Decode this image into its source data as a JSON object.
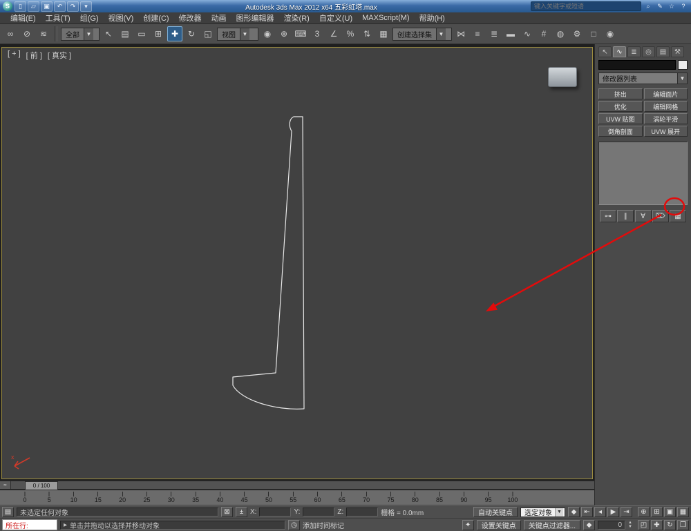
{
  "title_bar": {
    "title": "Autodesk 3ds Max 2012 x64  五彩虹塔.max",
    "search_placeholder": "键入关键字或短语",
    "quick_access": [
      {
        "name": "new-file-icon",
        "glyph": "▯"
      },
      {
        "name": "open-file-icon",
        "glyph": "▱"
      },
      {
        "name": "save-file-icon",
        "glyph": "▣"
      },
      {
        "name": "undo-icon",
        "glyph": "↶"
      },
      {
        "name": "redo-icon",
        "glyph": "↷"
      },
      {
        "name": "quick-access-dropdown-icon",
        "glyph": "▾"
      }
    ],
    "right_icons": [
      {
        "name": "search-icon",
        "glyph": "⌕"
      },
      {
        "name": "communication-center-icon",
        "glyph": "✎"
      },
      {
        "name": "favorites-star-icon",
        "glyph": "☆"
      },
      {
        "name": "help-icon",
        "glyph": "?"
      }
    ]
  },
  "menus": [
    "编辑(E)",
    "工具(T)",
    "组(G)",
    "视图(V)",
    "创建(C)",
    "修改器",
    "动画",
    "图形编辑器",
    "渲染(R)",
    "自定义(U)",
    "MAXScript(M)",
    "帮助(H)"
  ],
  "toolbar": {
    "filter_dropdown": "全部",
    "coord_dropdown": "视图",
    "selset_dropdown": "创建选择集",
    "group1": [
      {
        "name": "select-and-link-icon",
        "glyph": "∞"
      },
      {
        "name": "unlink-selection-icon",
        "glyph": "⊘"
      },
      {
        "name": "bind-to-space-warp-icon",
        "glyph": "≋"
      }
    ],
    "group2": [
      {
        "name": "select-object-icon",
        "glyph": "↖"
      },
      {
        "name": "select-by-name-icon",
        "glyph": "▤"
      },
      {
        "name": "rectangular-selection-region-icon",
        "glyph": "▭"
      },
      {
        "name": "window-crossing-toggle-icon",
        "glyph": "⊞"
      },
      {
        "name": "select-and-move-icon",
        "glyph": "✚",
        "active": true
      },
      {
        "name": "select-and-rotate-icon",
        "glyph": "↻"
      },
      {
        "name": "select-and-scale-icon",
        "glyph": "◱"
      }
    ],
    "group3": [
      {
        "name": "use-pivot-point-icon",
        "glyph": "◉"
      },
      {
        "name": "select-and-manipulate-icon",
        "glyph": "⊕"
      },
      {
        "name": "keyboard-shortcut-override-icon",
        "glyph": "⌨"
      },
      {
        "name": "snap-toggle-3d-icon",
        "glyph": "3"
      },
      {
        "name": "angle-snap-toggle-icon",
        "glyph": "∠"
      },
      {
        "name": "percent-snap-toggle-icon",
        "glyph": "%"
      },
      {
        "name": "spinner-snap-toggle-icon",
        "glyph": "⇅"
      },
      {
        "name": "edit-named-selection-sets-icon",
        "glyph": "▦"
      }
    ],
    "group4": [
      {
        "name": "mirror-icon",
        "glyph": "⋈"
      },
      {
        "name": "align-icon",
        "glyph": "≡"
      },
      {
        "name": "layer-manager-icon",
        "glyph": "≣"
      },
      {
        "name": "ribbon-toggle-icon",
        "glyph": "▬"
      },
      {
        "name": "curve-editor-icon",
        "glyph": "∿"
      },
      {
        "name": "schematic-view-icon",
        "glyph": "#"
      },
      {
        "name": "material-editor-icon",
        "glyph": "◍"
      },
      {
        "name": "render-setup-icon",
        "glyph": "⚙"
      },
      {
        "name": "rendered-frame-window-icon",
        "glyph": "□"
      },
      {
        "name": "render-production-icon",
        "glyph": "◉"
      }
    ]
  },
  "viewport": {
    "label_plus": "[ + ]",
    "label_view": "[ 前 ]",
    "label_shading": "[ 真实 ]",
    "spline_color": "#e8e8e8",
    "axis_x_label": "x"
  },
  "command_panel": {
    "tabs": [
      {
        "name": "tab-create",
        "glyph": "↖"
      },
      {
        "name": "tab-modify",
        "glyph": "∿",
        "active": true
      },
      {
        "name": "tab-hierarchy",
        "glyph": "≣"
      },
      {
        "name": "tab-motion",
        "glyph": "◎"
      },
      {
        "name": "tab-display",
        "glyph": "▤"
      },
      {
        "name": "tab-utilities",
        "glyph": "⚒"
      }
    ],
    "object_name": "",
    "modifier_list_label": "修改器列表",
    "modifier_buttons": [
      {
        "name": "extrude-button",
        "label": "挤出"
      },
      {
        "name": "edit-patch-button",
        "label": "编辑面片"
      },
      {
        "name": "optimize-button",
        "label": "优化"
      },
      {
        "name": "edit-mesh-button",
        "label": "编辑网格"
      },
      {
        "name": "uvw-map-button",
        "label": "UVW 贴图"
      },
      {
        "name": "turbosmooth-button",
        "label": "涡轮平滑"
      },
      {
        "name": "bevel-profile-button",
        "label": "倒角剖面"
      },
      {
        "name": "unwrap-uvw-button",
        "label": "UVW 展开"
      }
    ],
    "stack_tools": [
      {
        "name": "pin-stack-icon",
        "glyph": "⊶"
      },
      {
        "name": "show-end-result-icon",
        "glyph": "∥"
      },
      {
        "name": "make-unique-icon",
        "glyph": "∀"
      },
      {
        "name": "remove-modifier-icon",
        "glyph": "⌦"
      },
      {
        "name": "configure-modifier-sets-icon",
        "glyph": "▦"
      }
    ]
  },
  "timeline": {
    "slider_label": "0 / 100",
    "mini_curve_editor_glyph": "≈",
    "ticks": [
      "0",
      "5",
      "10",
      "15",
      "20",
      "25",
      "30",
      "35",
      "40",
      "45",
      "50",
      "55",
      "60",
      "65",
      "70",
      "75",
      "80",
      "85",
      "90",
      "95",
      "100"
    ]
  },
  "status": {
    "left_icon_glyph": "▤",
    "selection_text": "未选定任何对象",
    "lock_glyph": "⊠",
    "absolute_glyph": "±",
    "x_label": "X:",
    "y_label": "Y:",
    "z_label": "Z:",
    "x_value": "",
    "y_value": "",
    "z_value": "",
    "grid_label": "栅格 = 0.0mm",
    "autokey_label": "自动关键点",
    "selset_label": "选定对象",
    "setkey_glyph": "✦",
    "setkey_label": "设置关键点",
    "keyfilter_label": "关键点过滤器...",
    "timetag_glyph": "◷",
    "addtag_label": "添加时间标记",
    "listener_label": "所在行:",
    "prompt_glyph": "▸",
    "prompt_text": "单击并拖动以选择并移动对象",
    "keymode_glyph": "◆",
    "frame_value": "0",
    "spinner_up": "▲",
    "spinner_down": "▼",
    "transport": [
      {
        "name": "key-toggle-icon",
        "glyph": "◆"
      },
      {
        "name": "go-to-start-icon",
        "glyph": "⇤"
      },
      {
        "name": "previous-frame-icon",
        "glyph": "◂"
      },
      {
        "name": "play-animation-icon",
        "glyph": "▶"
      },
      {
        "name": "go-to-end-icon",
        "glyph": "⇥"
      }
    ],
    "vpnav_row1": [
      {
        "name": "zoom-icon",
        "glyph": "⊕"
      },
      {
        "name": "zoom-all-icon",
        "glyph": "⊞"
      },
      {
        "name": "zoom-extents-icon",
        "glyph": "▣"
      },
      {
        "name": "zoom-extents-all-icon",
        "glyph": "▦"
      }
    ],
    "vpnav_row2": [
      {
        "name": "zoom-region-icon",
        "glyph": "◰"
      },
      {
        "name": "pan-view-icon",
        "glyph": "✚"
      },
      {
        "name": "orbit-icon",
        "glyph": "↻"
      },
      {
        "name": "maximize-viewport-toggle-icon",
        "glyph": "❒"
      }
    ]
  },
  "annotation": {
    "color": "#e30b0b"
  }
}
